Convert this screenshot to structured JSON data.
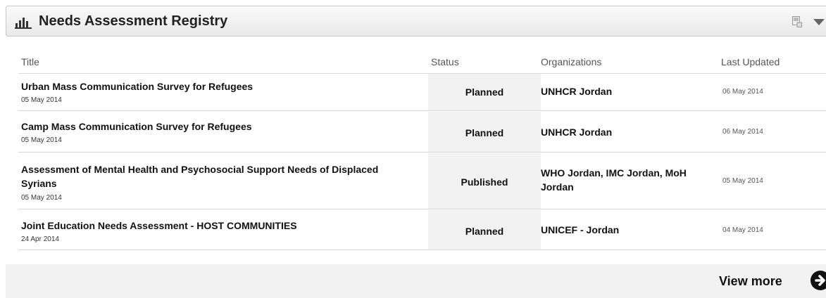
{
  "widget": {
    "title": "Needs Assessment Registry",
    "header_icon": "bar-chart-icon",
    "export_icon": "export-icon",
    "menu_icon": "caret-down-icon"
  },
  "table": {
    "columns": [
      "Title",
      "Status",
      "Organizations",
      "Last Updated"
    ],
    "rows": [
      {
        "title": "Urban Mass Communication Survey for Refugees",
        "date": "05 May 2014",
        "status": "Planned",
        "organizations": "UNHCR Jordan",
        "last_updated": "06 May 2014"
      },
      {
        "title": "Camp Mass Communication Survey for Refugees",
        "date": "05 May 2014",
        "status": "Planned",
        "organizations": "UNHCR Jordan",
        "last_updated": "06 May 2014"
      },
      {
        "title": "Assessment of Mental Health and Psychosocial Support Needs of Displaced Syrians",
        "date": "05 May 2014",
        "status": "Published",
        "organizations": "WHO Jordan, IMC Jordan, MoH Jordan",
        "last_updated": "05 May 2014"
      },
      {
        "title": "Joint Education Needs Assessment - HOST COMMUNITIES",
        "date": "24 Apr 2014",
        "status": "Planned",
        "organizations": "UNICEF - Jordan",
        "last_updated": "04 May 2014"
      }
    ]
  },
  "footer": {
    "view_more_label": "View more",
    "arrow_icon": "arrow-right-circle-icon"
  }
}
